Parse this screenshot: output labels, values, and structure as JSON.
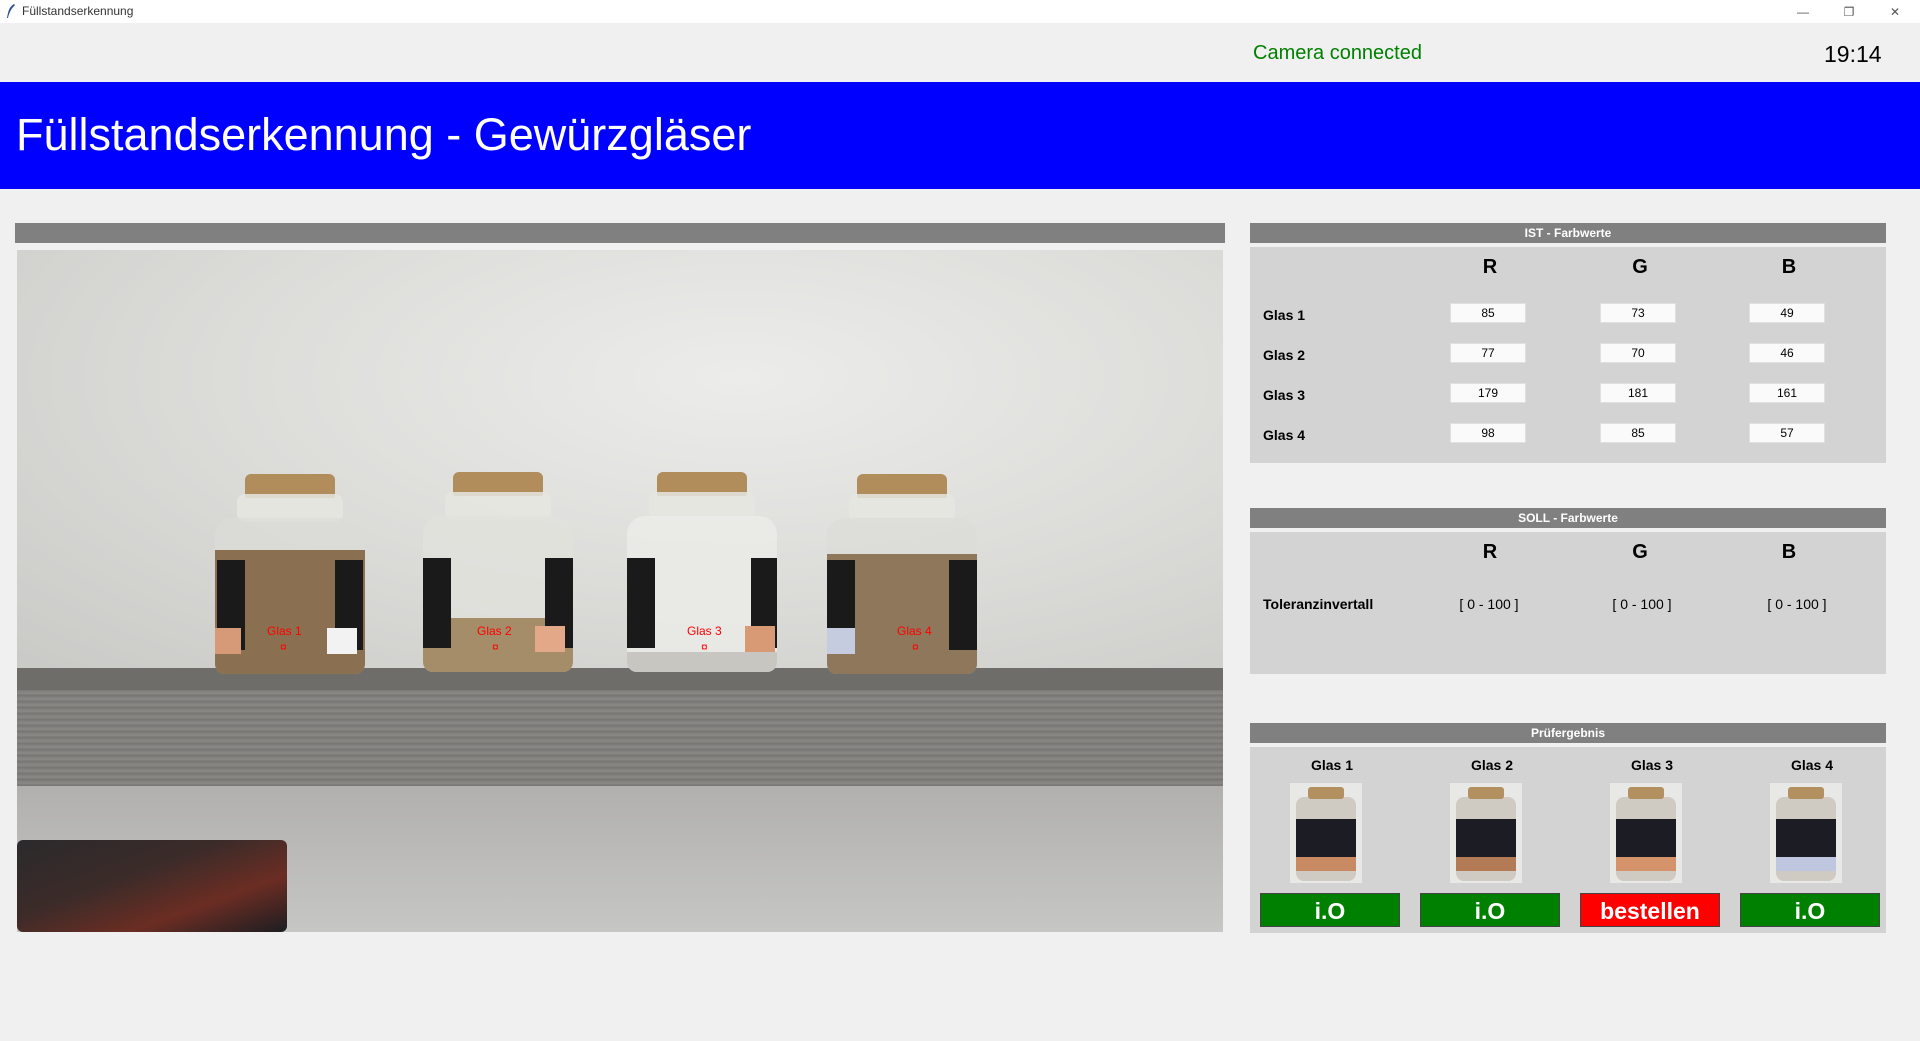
{
  "window": {
    "title": "Füllstandserkennung",
    "minimize_glyph": "—",
    "maximize_glyph": "❐",
    "close_glyph": "✕"
  },
  "status": {
    "camera": "Camera connected",
    "camera_color": "#008000",
    "time": "19:14"
  },
  "header": {
    "title": "Füllstandserkennung - Gewürzgläser",
    "color": "#0000ff"
  },
  "camera_view": {
    "jars": [
      {
        "label": "Glas 1",
        "marker": "¤"
      },
      {
        "label": "Glas 2",
        "marker": "¤"
      },
      {
        "label": "Glas 3",
        "marker": "¤"
      },
      {
        "label": "Glas 4",
        "marker": "¤"
      }
    ]
  },
  "ist": {
    "title": "IST - Farbwerte",
    "columns": [
      "R",
      "G",
      "B"
    ],
    "rows": [
      {
        "label": "Glas 1",
        "values": [
          "85",
          "73",
          "49"
        ]
      },
      {
        "label": "Glas 2",
        "values": [
          "77",
          "70",
          "46"
        ]
      },
      {
        "label": "Glas 3",
        "values": [
          "179",
          "181",
          "161"
        ]
      },
      {
        "label": "Glas 4",
        "values": [
          "98",
          "85",
          "57"
        ]
      }
    ]
  },
  "soll": {
    "title": "SOLL - Farbwerte",
    "columns": [
      "R",
      "G",
      "B"
    ],
    "row_label": "Toleranzinvertall",
    "values": [
      "[ 0 - 100 ]",
      "[ 0 - 100 ]",
      "[ 0 - 100 ]"
    ]
  },
  "result": {
    "title": "Prüfergebnis",
    "items": [
      {
        "name": "Glas 1",
        "status": "i.O",
        "color": "#008000"
      },
      {
        "name": "Glas 2",
        "status": "i.O",
        "color": "#008000"
      },
      {
        "name": "Glas 3",
        "status": "bestellen",
        "color": "#ff0000"
      },
      {
        "name": "Glas 4",
        "status": "i.O",
        "color": "#008000"
      }
    ]
  }
}
